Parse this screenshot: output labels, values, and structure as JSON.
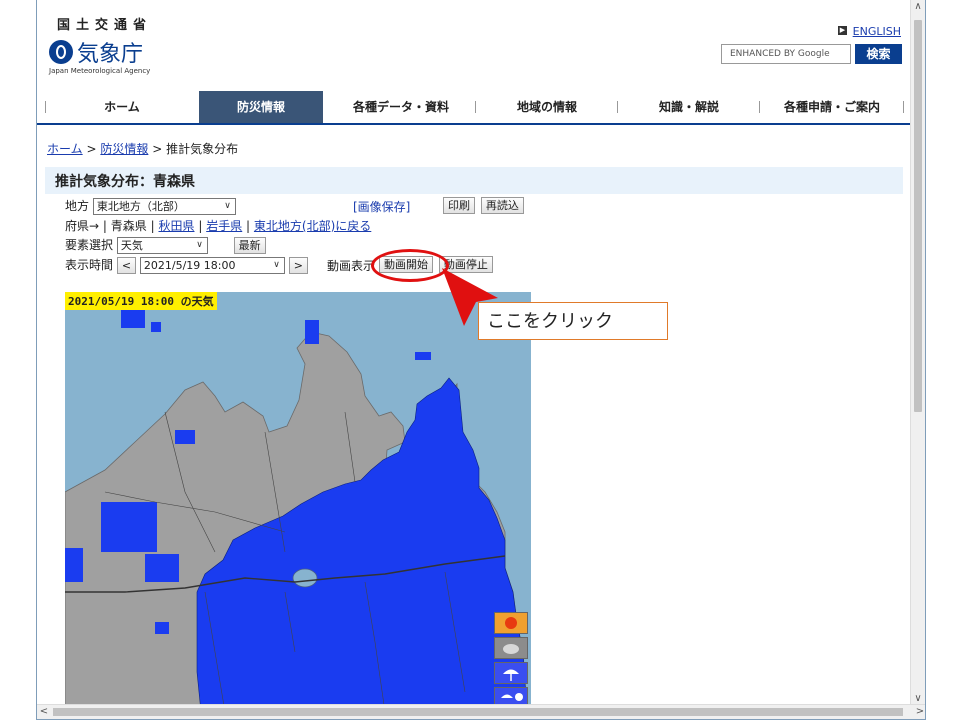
{
  "header": {
    "ministry": "国土交通省",
    "agency": "気象庁",
    "agency_en": "Japan Meteorological Agency",
    "english_link": "ENGLISH",
    "search_placeholder": "ENHANCED BY Google",
    "search_button": "検索"
  },
  "nav": {
    "items": [
      "ホーム",
      "防災情報",
      "各種データ・資料",
      "地域の情報",
      "知識・解説",
      "各種申請・ご案内"
    ],
    "active": "防災情報"
  },
  "breadcrumb": {
    "home": "ホーム",
    "sep1": ">",
    "bousai": "防災情報",
    "sep2": ">",
    "current": "推計気象分布"
  },
  "page_title": "推計気象分布：青森県",
  "controls": {
    "region_label": "地方",
    "region_value": "東北地方（北部）",
    "image_save": "[画像保存]",
    "print": "印刷",
    "reload": "再読込",
    "pref_label": "府県→",
    "pref_sep": "|",
    "pref_current": "青森県",
    "pref_akita": "秋田県",
    "pref_iwate": "岩手県",
    "back_link": "東北地方(北部)に戻る",
    "element_label": "要素選択",
    "element_value": "天気",
    "latest": "最新",
    "time_label": "表示時間",
    "prev": "<",
    "time_value": "2021/5/19 18:00",
    "next": ">",
    "anim_label": "動画表示",
    "anim_start": "動画開始",
    "anim_stop": "動画停止"
  },
  "map": {
    "label": "2021/05/19 18:00 の天気",
    "colors": {
      "sea": "#87b3cf",
      "land": "#a0a0a0",
      "rain": "#1a3cf0"
    }
  },
  "legend": [
    "sunny-icon",
    "cloudy-icon",
    "rain-icon",
    "snow-icon"
  ],
  "callout": "ここをクリック"
}
